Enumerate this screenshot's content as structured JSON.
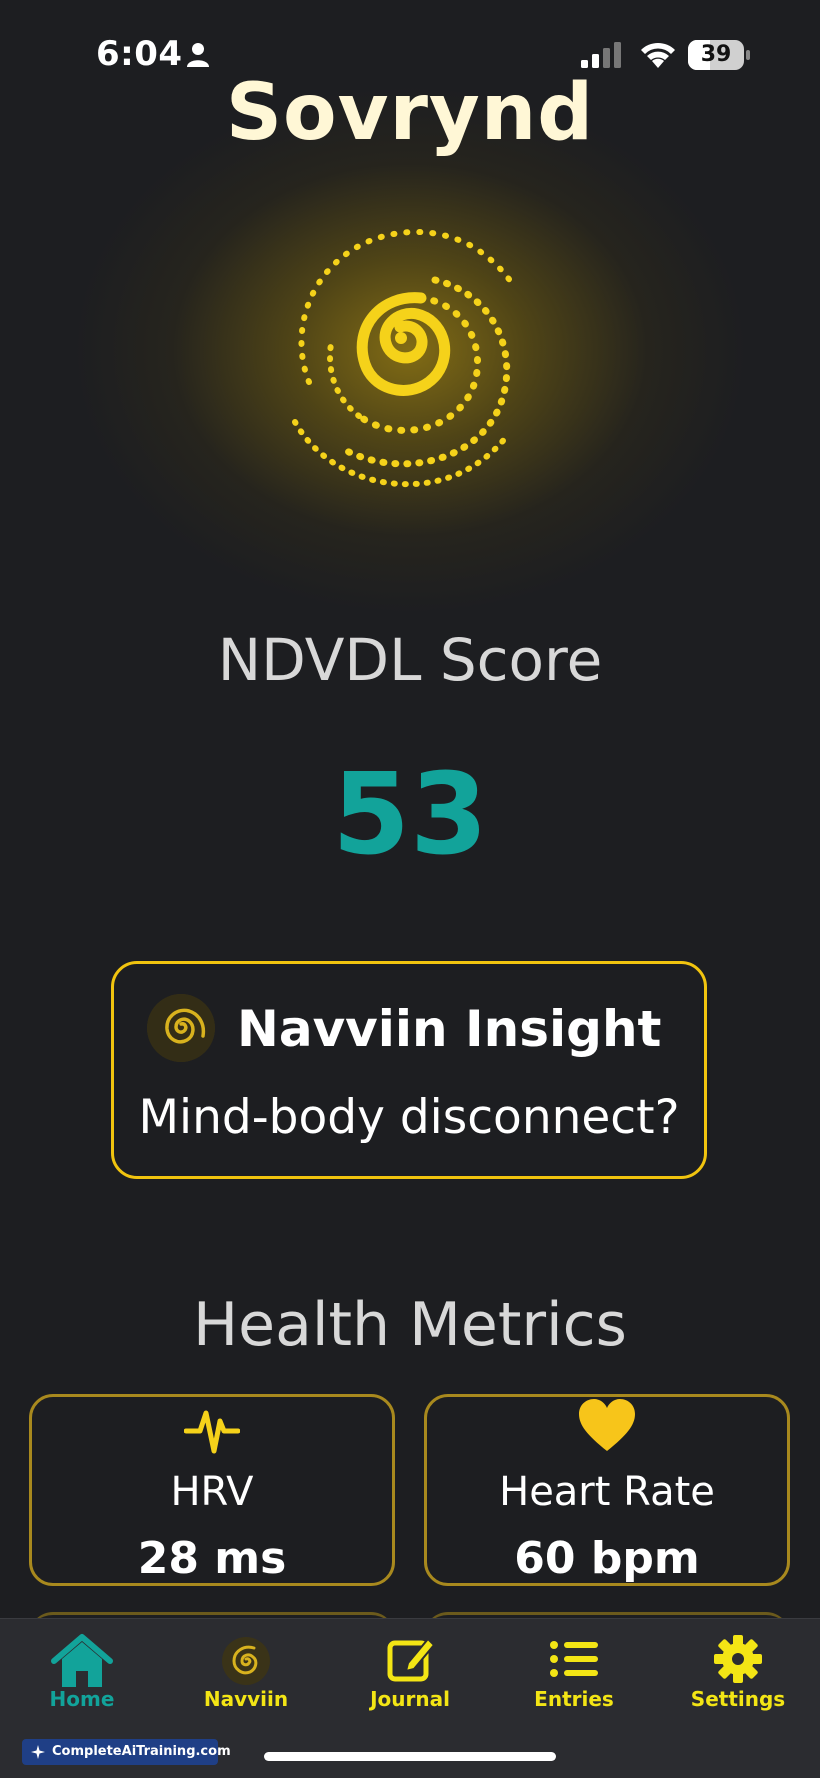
{
  "status_bar": {
    "time": "6:04",
    "battery_level": "39",
    "icons": [
      "person-icon",
      "signal-icon",
      "wifi-icon",
      "battery-icon"
    ]
  },
  "app_title": "Sovrynd",
  "score": {
    "label": "NDVDL Score",
    "value": "53"
  },
  "insight": {
    "title": "Navviin Insight",
    "text": "Mind-body disconnect?"
  },
  "health": {
    "title": "Health Metrics",
    "metrics": [
      {
        "label": "HRV",
        "value": "28 ms",
        "icon": "pulse-icon"
      },
      {
        "label": "Heart Rate",
        "value": "60 bpm",
        "icon": "heart-icon"
      }
    ]
  },
  "tabs": [
    {
      "label": "Home",
      "icon": "home-icon",
      "active": true
    },
    {
      "label": "Navviin",
      "icon": "spiral-icon",
      "active": false
    },
    {
      "label": "Journal",
      "icon": "edit-icon",
      "active": false
    },
    {
      "label": "Entries",
      "icon": "list-icon",
      "active": false
    },
    {
      "label": "Settings",
      "icon": "gear-icon",
      "active": false
    }
  ],
  "watermark": "CompleteAiTraining.com",
  "colors": {
    "background": "#1d1e21",
    "accent_teal": "#12a39a",
    "accent_yellow": "#f3e515",
    "card_border": "#f1c40f"
  }
}
